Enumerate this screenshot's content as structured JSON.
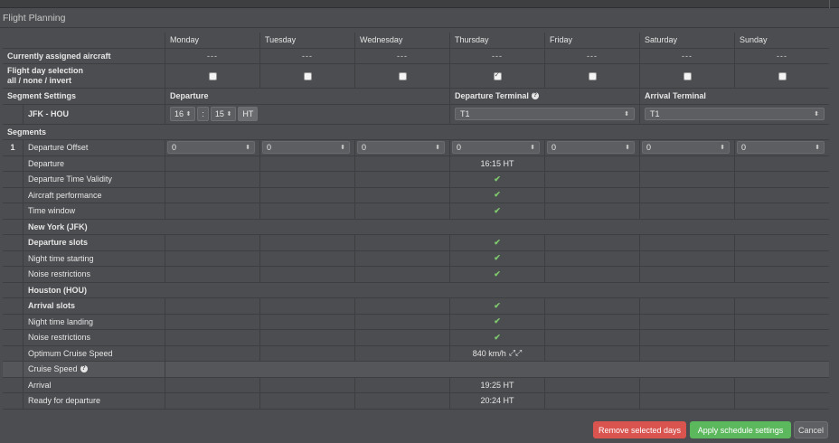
{
  "window": {
    "title": "Flight Planning"
  },
  "days": [
    "Monday",
    "Tuesday",
    "Wednesday",
    "Thursday",
    "Friday",
    "Saturday",
    "Sunday"
  ],
  "labels": {
    "assigned": "Currently assigned aircraft",
    "flight_day": "Flight day selection",
    "all": "all",
    "none": "none",
    "invert": "invert",
    "seg_settings": "Segment Settings",
    "departure": "Departure",
    "dep_terminal": "Departure Terminal",
    "arr_terminal": "Arrival Terminal",
    "route": "JFK - HOU",
    "segments": "Segments",
    "seg_num": "1",
    "dep_offset": "Departure Offset"
  },
  "assigned_values": [
    "---",
    "---",
    "---",
    "---",
    "---",
    "---",
    "---"
  ],
  "day_checked": [
    false,
    false,
    false,
    true,
    false,
    false,
    false
  ],
  "departure_time": {
    "hour": "16",
    "colon": ":",
    "minute": "15",
    "zone": "HT"
  },
  "dep_terminal_value": "T1",
  "arr_terminal_value": "T1",
  "offsets": [
    "0",
    "0",
    "0",
    "0",
    "0",
    "0",
    "0"
  ],
  "segment_rows": [
    {
      "label": "Departure",
      "bold": false,
      "thursday": "16:15 HT"
    },
    {
      "label": "Departure Time Validity",
      "bold": false,
      "thursday": "check"
    },
    {
      "label": "Aircraft performance",
      "bold": false,
      "thursday": "check"
    },
    {
      "label": "Time window",
      "bold": false,
      "thursday": "check"
    },
    {
      "label": "New York (JFK)",
      "bold": true,
      "header": true
    },
    {
      "label": "Departure slots",
      "bold": true,
      "thursday": "check"
    },
    {
      "label": "Night time starting",
      "bold": false,
      "thursday": "check"
    },
    {
      "label": "Noise restrictions",
      "bold": false,
      "thursday": "check"
    },
    {
      "label": "Houston (HOU)",
      "bold": true,
      "header": true
    },
    {
      "label": "Arrival slots",
      "bold": true,
      "thursday": "check"
    },
    {
      "label": "Night time landing",
      "bold": false,
      "thursday": "check"
    },
    {
      "label": "Noise restrictions",
      "bold": false,
      "thursday": "check"
    },
    {
      "label": "Optimum Cruise Speed",
      "bold": false,
      "thursday": "840 km/h"
    },
    {
      "label": "Cruise Speed",
      "bold": false,
      "grey": true,
      "help": true
    },
    {
      "label": "Arrival",
      "bold": false,
      "thursday": "19:25 HT"
    },
    {
      "label": "Ready for departure",
      "bold": false,
      "thursday": "20:24 HT"
    }
  ],
  "buttons": {
    "remove": "Remove selected days",
    "apply": "Apply schedule settings",
    "cancel": "Cancel"
  },
  "colors": {
    "danger": "#d9534f",
    "success": "#5cb85c",
    "check": "#7ec86d"
  }
}
